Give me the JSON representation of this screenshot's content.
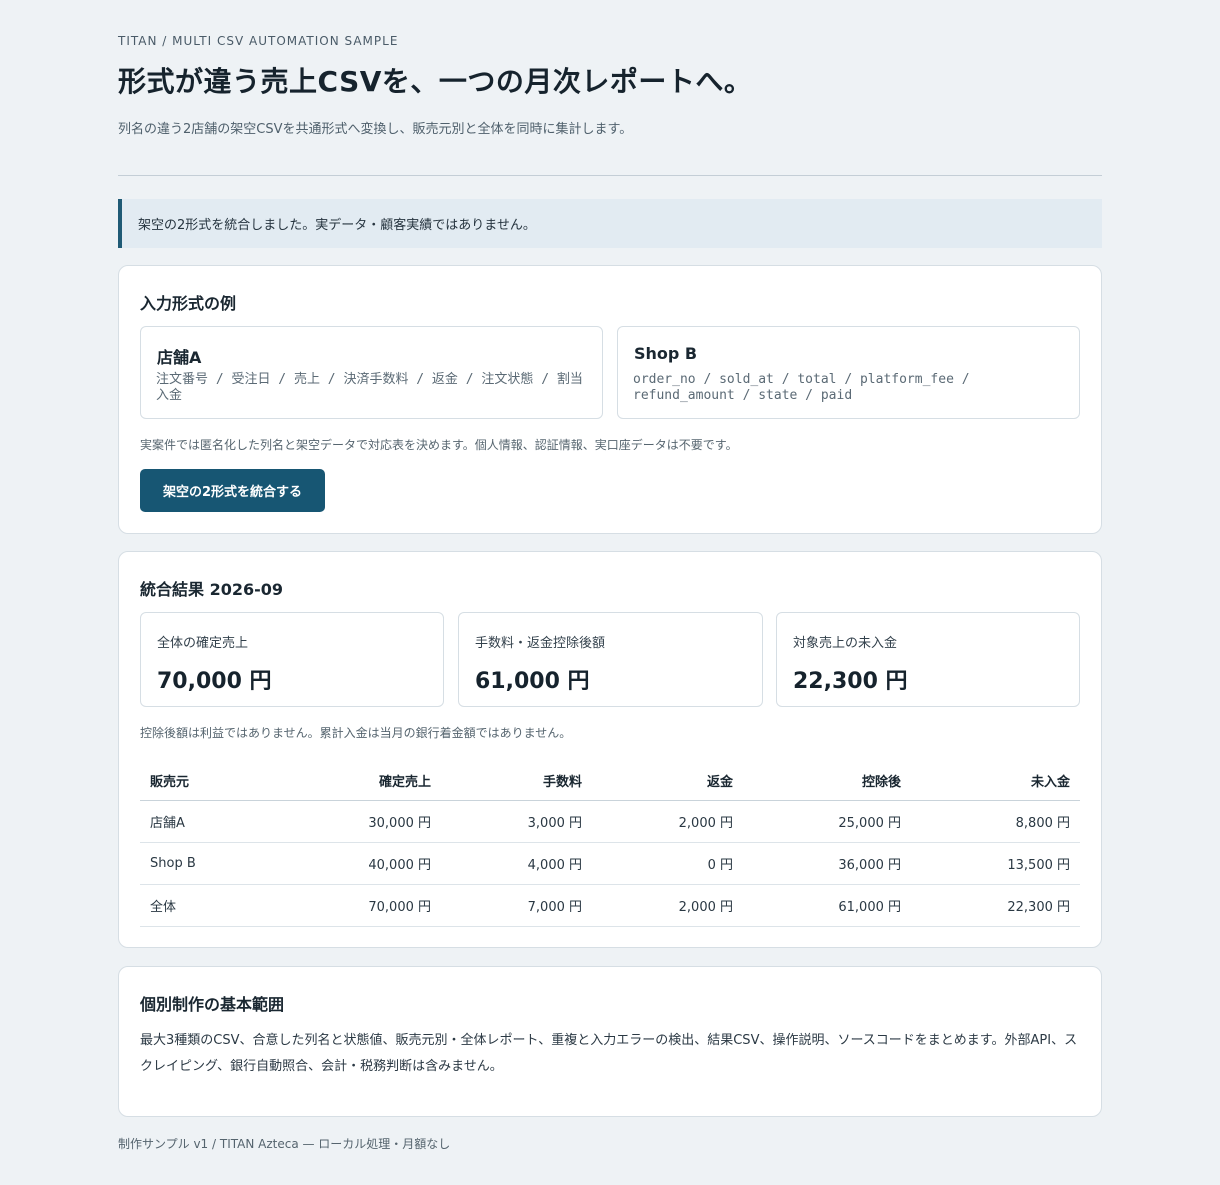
{
  "header": {
    "eyebrow": "TITAN / MULTI CSV AUTOMATION SAMPLE",
    "title": "形式が違う売上CSVを、一つの月次レポートへ。",
    "subtitle": "列名の違う2店舗の架空CSVを共通形式へ変換し、販売元別と全体を同時に集計します。"
  },
  "notice": "架空の2形式を統合しました。実データ・顧客実績ではありません。",
  "input_formats": {
    "title": "入力形式の例",
    "shop_a": {
      "name": "店舗A",
      "columns": "注文番号 / 受注日 / 売上 / 決済手数料 / 返金 / 注文状態 / 割当入金"
    },
    "shop_b": {
      "name": "Shop B",
      "columns": "order_no / sold_at / total / platform_fee / refund_amount / state / paid"
    },
    "note": "実案件では匿名化した列名と架空データで対応表を決めます。個人情報、認証情報、実口座データは不要です。",
    "button_label": "架空の2形式を統合する"
  },
  "result": {
    "title": "統合結果 2026-09",
    "kpis": [
      {
        "label": "全体の確定売上",
        "value": "70,000 円"
      },
      {
        "label": "手数料・返金控除後額",
        "value": "61,000 円"
      },
      {
        "label": "対象売上の未入金",
        "value": "22,300 円"
      }
    ],
    "note": "控除後額は利益ではありません。累計入金は当月の銀行着金額ではありません。",
    "table": {
      "headers": [
        "販売元",
        "確定売上",
        "手数料",
        "返金",
        "控除後",
        "未入金"
      ],
      "rows": [
        [
          "店舗A",
          "30,000 円",
          "3,000 円",
          "2,000 円",
          "25,000 円",
          "8,800 円"
        ],
        [
          "Shop B",
          "40,000 円",
          "4,000 円",
          "0 円",
          "36,000 円",
          "13,500 円"
        ],
        [
          "全体",
          "70,000 円",
          "7,000 円",
          "2,000 円",
          "61,000 円",
          "22,300 円"
        ]
      ]
    }
  },
  "scope": {
    "title": "個別制作の基本範囲",
    "text": "最大3種類のCSV、合意した列名と状態値、販売元別・全体レポート、重複と入力エラーの検出、結果CSV、操作説明、ソースコードをまとめます。外部API、スクレイピング、銀行自動照合、会計・税務判断は含みません。"
  },
  "footer": "制作サンプル v1 / TITAN Azteca — ローカル処理・月額なし",
  "colors": {
    "background": "#eef2f5",
    "accent": "#175673",
    "notice_bg": "#e2ebf2"
  }
}
